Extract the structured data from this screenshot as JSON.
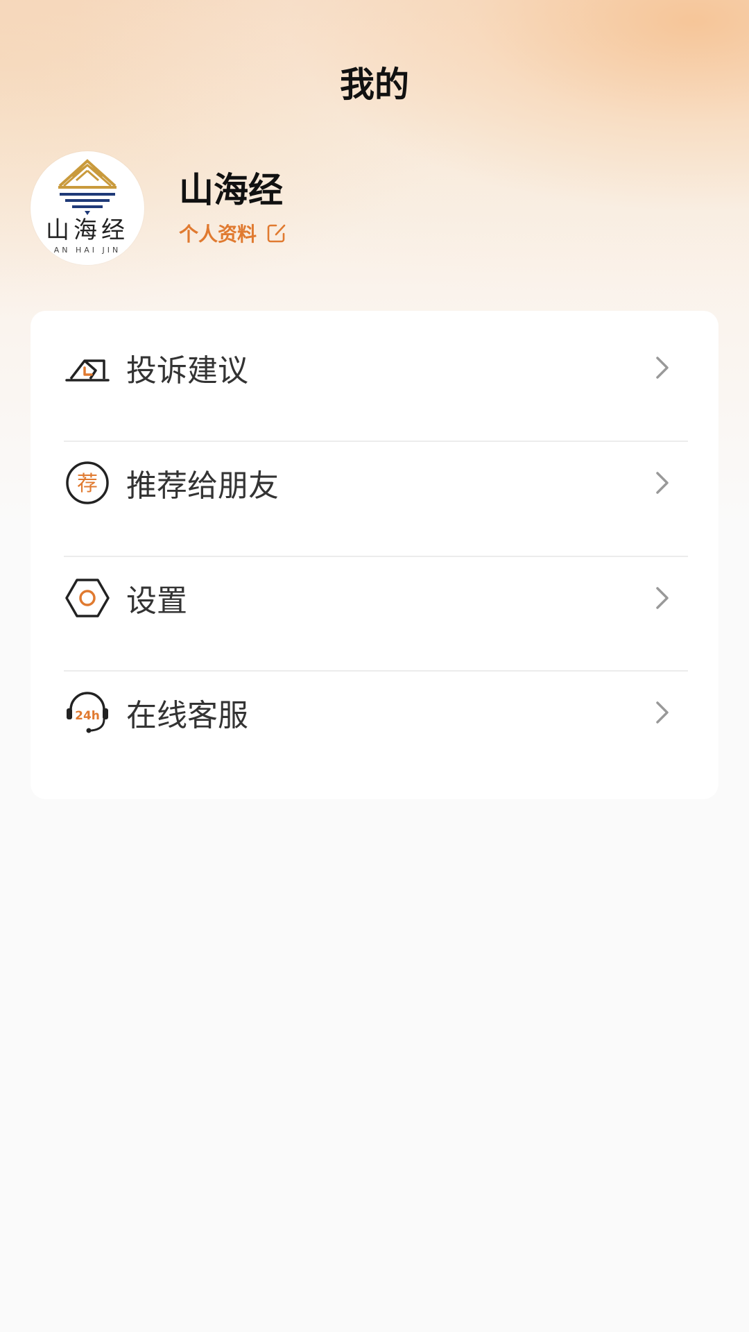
{
  "header": {
    "title": "我的"
  },
  "profile": {
    "avatar_logo_text": "山海经",
    "avatar_logo_subtext": "AN HAI JIN",
    "name": "山海经",
    "edit_link_label": "个人资料",
    "edit_icon": "edit-icon"
  },
  "menu": {
    "items": [
      {
        "label": "投诉建议",
        "icon": "complaint-icon"
      },
      {
        "label": "推荐给朋友",
        "icon": "recommend-icon",
        "icon_text": "荐"
      },
      {
        "label": "设置",
        "icon": "settings-icon"
      },
      {
        "label": "在线客服",
        "icon": "customer-service-icon",
        "icon_text": "24h"
      }
    ],
    "chevron_icon": "chevron-right-icon"
  },
  "colors": {
    "accent": "#e07a30",
    "title": "#111111",
    "menu_text": "#333333",
    "chevron": "#999999",
    "logo_gold": "#c99a3c",
    "logo_navy": "#1f3a78"
  }
}
